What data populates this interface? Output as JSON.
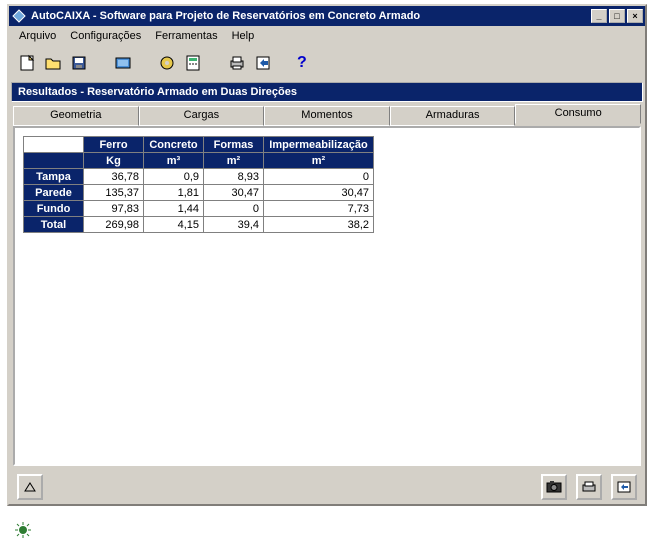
{
  "window": {
    "title": "AutoCAIXA - Software para Projeto de Reservatórios em Concreto Armado"
  },
  "menu": {
    "arquivo": "Arquivo",
    "config": "Configurações",
    "ferramentas": "Ferramentas",
    "help": "Help"
  },
  "subheader": "Resultados - Reservatório Armado em Duas Direções",
  "tabs": {
    "geometria": "Geometria",
    "cargas": "Cargas",
    "momentos": "Momentos",
    "armaduras": "Armaduras",
    "consumo": "Consumo"
  },
  "table": {
    "headers": {
      "ferro": "Ferro",
      "concreto": "Concreto",
      "formas": "Formas",
      "imperme": "Impermeabilização"
    },
    "units": {
      "ferro": "Kg",
      "concreto": "m³",
      "formas": "m²",
      "imperme": "m²"
    },
    "rows": [
      {
        "label": "Tampa",
        "ferro": "36,78",
        "concreto": "0,9",
        "formas": "8,93",
        "imperme": "0"
      },
      {
        "label": "Parede",
        "ferro": "135,37",
        "concreto": "1,81",
        "formas": "30,47",
        "imperme": "30,47"
      },
      {
        "label": "Fundo",
        "ferro": "97,83",
        "concreto": "1,44",
        "formas": "0",
        "imperme": "7,73"
      },
      {
        "label": "Total",
        "ferro": "269,98",
        "concreto": "4,15",
        "formas": "39,4",
        "imperme": "38,2"
      }
    ]
  },
  "help_glyph": "?"
}
